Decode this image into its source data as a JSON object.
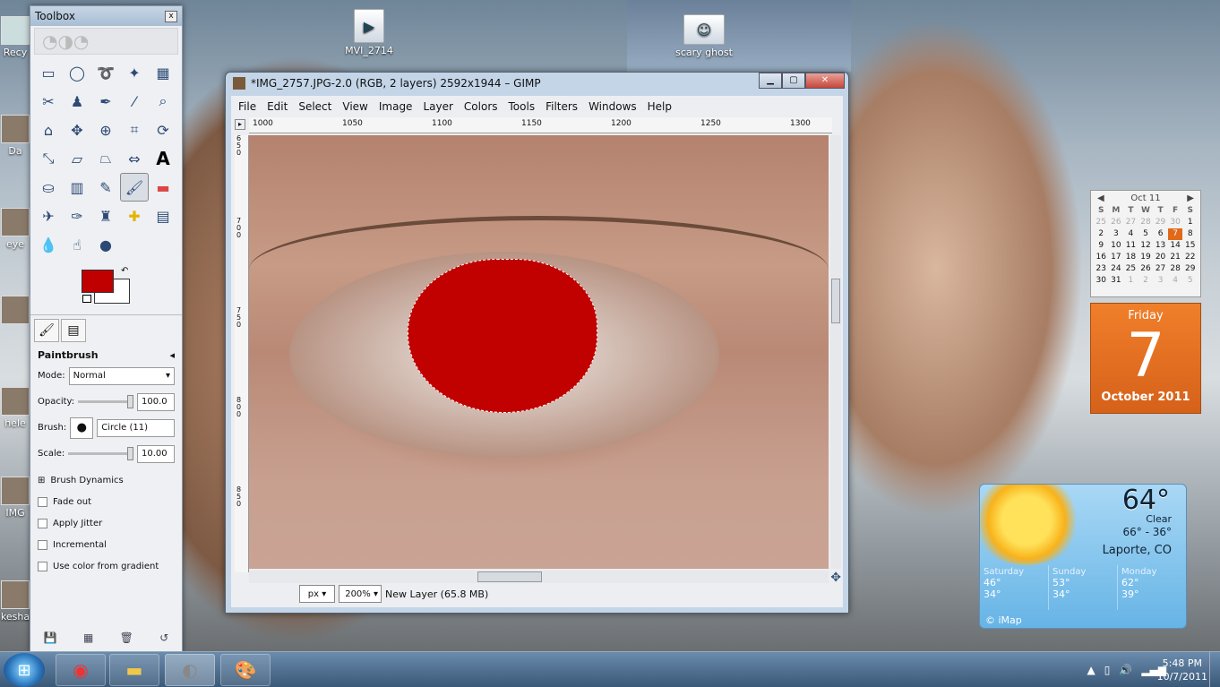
{
  "desktop": {
    "icons": [
      {
        "label": "MVI_2714",
        "icon": "video-file-icon"
      },
      {
        "label": "scary ghost",
        "icon": "image-file-icon"
      }
    ],
    "edge_labels": [
      "Recy",
      "Da",
      "eye",
      "",
      "hele",
      "IMG",
      "kesha"
    ]
  },
  "toolbox": {
    "title": "Toolbox",
    "close": "x",
    "tool_options": {
      "title": "Paintbrush",
      "mode_label": "Mode:",
      "mode_value": "Normal",
      "opacity_label": "Opacity:",
      "opacity_value": "100.0",
      "brush_label": "Brush:",
      "brush_value": "Circle (11)",
      "scale_label": "Scale:",
      "scale_value": "10.00",
      "dynamics_label": "Brush Dynamics",
      "checkboxes": [
        "Fade out",
        "Apply Jitter",
        "Incremental",
        "Use color from gradient"
      ]
    },
    "fg_color": "#c00000",
    "bg_color": "#ffffff"
  },
  "gimp": {
    "title": "*IMG_2757.JPG-2.0 (RGB, 2 layers) 2592x1944 – GIMP",
    "menu": [
      "File",
      "Edit",
      "Select",
      "View",
      "Image",
      "Layer",
      "Colors",
      "Tools",
      "Filters",
      "Windows",
      "Help"
    ],
    "ruler_h": [
      "1000",
      "1050",
      "1100",
      "1150",
      "1200",
      "1250",
      "1300"
    ],
    "ruler_v": [
      "650",
      "700",
      "750",
      "800",
      "850"
    ],
    "status": {
      "unit": "px",
      "zoom": "200%",
      "layer": "New Layer (65.8 MB)"
    },
    "pupil_color": "#c10000"
  },
  "calendar": {
    "month": "Oct 11",
    "dow": [
      "S",
      "M",
      "T",
      "W",
      "T",
      "F",
      "S"
    ],
    "weeks": [
      [
        "25",
        "26",
        "27",
        "28",
        "29",
        "30",
        "1"
      ],
      [
        "2",
        "3",
        "4",
        "5",
        "6",
        "7",
        "8"
      ],
      [
        "9",
        "10",
        "11",
        "12",
        "13",
        "14",
        "15"
      ],
      [
        "16",
        "17",
        "18",
        "19",
        "20",
        "21",
        "22"
      ],
      [
        "23",
        "24",
        "25",
        "26",
        "27",
        "28",
        "29"
      ],
      [
        "30",
        "31",
        "1",
        "2",
        "3",
        "4",
        "5"
      ]
    ],
    "weekday": "Friday",
    "day": "7",
    "month_year": "October 2011"
  },
  "weather": {
    "temp": "64°",
    "condition": "Clear",
    "hilo": "66° - 36°",
    "location": "Laporte, CO",
    "forecast": [
      {
        "day": "Saturday",
        "hi": "46°",
        "lo": "34°"
      },
      {
        "day": "Sunday",
        "hi": "53°",
        "lo": "34°"
      },
      {
        "day": "Monday",
        "hi": "62°",
        "lo": "39°"
      }
    ],
    "credit": "© iMap"
  },
  "taskbar": {
    "time": "5:48 PM",
    "date": "10/7/2011"
  }
}
